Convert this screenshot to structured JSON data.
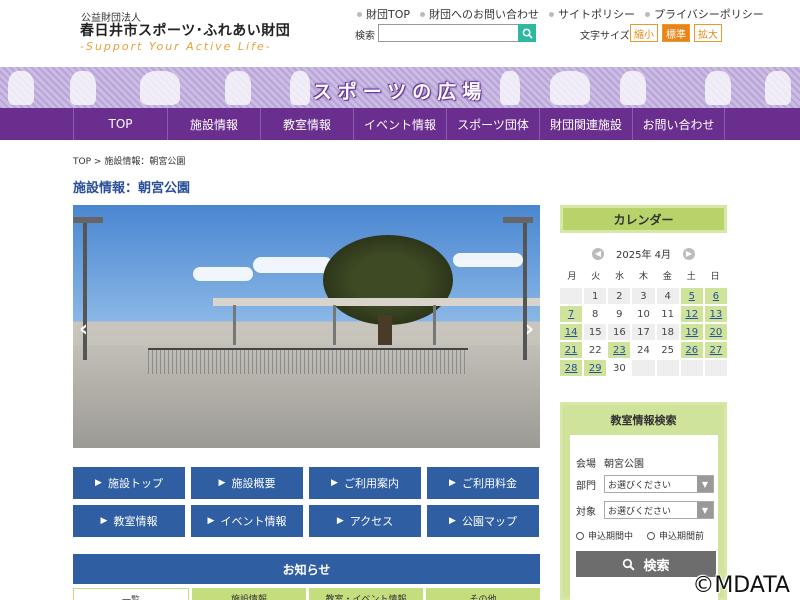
{
  "header": {
    "org_small": "公益財団法人",
    "org_name": "春日井市スポーツ･ふれあい財団",
    "tagline": "-Support Your Active Life-",
    "links": [
      "財団TOP",
      "財団へのお問い合わせ",
      "サイトポリシー",
      "プライバシーポリシー"
    ],
    "search_label": "検索",
    "search_value": "",
    "fontsize_label": "文字サイズ",
    "fontsize_options": [
      "縮小",
      "標準",
      "拡大"
    ],
    "fontsize_selected": "標準"
  },
  "banner": {
    "title": "スポーツの広場"
  },
  "mainnav": [
    "TOP",
    "施設情報",
    "教室情報",
    "イベント情報",
    "スポーツ団体",
    "財団関連施設",
    "お問い合わせ"
  ],
  "breadcrumb": {
    "home": "TOP",
    "sep": ">",
    "current": "施設情報：朝宮公園"
  },
  "page_title": "施設情報：朝宮公園",
  "facility_buttons": [
    "施設トップ",
    "施設概要",
    "ご利用案内",
    "ご利用料金",
    "教室情報",
    "イベント情報",
    "アクセス",
    "公園マップ"
  ],
  "news": {
    "title": "お知らせ",
    "tabs": [
      "一覧",
      "施設情報",
      "教室・イベント情報",
      "その他"
    ]
  },
  "calendar": {
    "title": "カレンダー",
    "month": "2025年 4月",
    "weekdays": [
      "月",
      "火",
      "水",
      "木",
      "金",
      "土",
      "日"
    ],
    "days": [
      {
        "d": "",
        "s": "empty"
      },
      {
        "d": "1",
        "s": "closed"
      },
      {
        "d": "2",
        "s": "closed"
      },
      {
        "d": "3",
        "s": "closed"
      },
      {
        "d": "4",
        "s": "closed"
      },
      {
        "d": "5",
        "s": "open"
      },
      {
        "d": "6",
        "s": "open"
      },
      {
        "d": "7",
        "s": "open"
      },
      {
        "d": "8",
        "s": "plain"
      },
      {
        "d": "9",
        "s": "plain"
      },
      {
        "d": "10",
        "s": "plain"
      },
      {
        "d": "11",
        "s": "plain"
      },
      {
        "d": "12",
        "s": "open"
      },
      {
        "d": "13",
        "s": "open"
      },
      {
        "d": "14",
        "s": "open"
      },
      {
        "d": "15",
        "s": "closed"
      },
      {
        "d": "16",
        "s": "closed"
      },
      {
        "d": "17",
        "s": "closed"
      },
      {
        "d": "18",
        "s": "closed"
      },
      {
        "d": "19",
        "s": "open"
      },
      {
        "d": "20",
        "s": "open"
      },
      {
        "d": "21",
        "s": "open"
      },
      {
        "d": "22",
        "s": "plain"
      },
      {
        "d": "23",
        "s": "open"
      },
      {
        "d": "24",
        "s": "plain"
      },
      {
        "d": "25",
        "s": "plain"
      },
      {
        "d": "26",
        "s": "open"
      },
      {
        "d": "27",
        "s": "open"
      },
      {
        "d": "28",
        "s": "open"
      },
      {
        "d": "29",
        "s": "open"
      },
      {
        "d": "30",
        "s": "plain"
      },
      {
        "d": "",
        "s": "empty"
      },
      {
        "d": "",
        "s": "empty"
      },
      {
        "d": "",
        "s": "empty"
      },
      {
        "d": "",
        "s": "empty"
      }
    ]
  },
  "class_search": {
    "title": "教室情報検索",
    "venue_label": "会場",
    "venue_value": "朝宮公園",
    "dept_label": "部門",
    "dept_value": "お選びください",
    "target_label": "対象",
    "target_value": "お選びください",
    "radio1": "申込期間中",
    "radio2": "申込期間前",
    "search_button": "検索"
  },
  "watermark": "©MDATA",
  "colors": {
    "nav": "#6a2f8e",
    "button": "#2f5ea3",
    "calendar": "#b7d36a",
    "accent": "#e8841a"
  }
}
